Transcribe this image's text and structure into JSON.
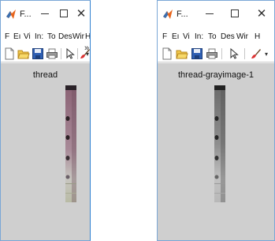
{
  "windows": [
    {
      "title": "F...",
      "menu": [
        "F",
        "Eı",
        "Vi",
        "In:",
        "To",
        "Des",
        "Wir",
        "H",
        "↘"
      ],
      "toolbar_overflow": "»",
      "figure_title": "thread",
      "image_kind": "color"
    },
    {
      "title": "F...",
      "menu": [
        "F",
        "Eı",
        "Vi",
        "In:",
        "To",
        "Des",
        "Wir",
        "H"
      ],
      "figure_title": "thread-grayimage-1",
      "image_kind": "gray"
    }
  ],
  "icons": {
    "app": "matlab-icon",
    "minimize": "minimize-icon",
    "maximize": "maximize-icon",
    "close": "close-icon",
    "new": "new-figure-icon",
    "open": "open-file-icon",
    "save": "save-icon",
    "print": "print-icon",
    "pointer": "pointer-icon",
    "brush": "brush-icon"
  },
  "colors": {
    "figure_bg": "#cfcfcf",
    "window_border": "#2f7fd0",
    "thread_color_top": "#8a6274",
    "thread_color_bottom": "#b9bba5",
    "thread_gray_top": "#6b6b6b",
    "thread_gray_bottom": "#b8b8b8"
  }
}
